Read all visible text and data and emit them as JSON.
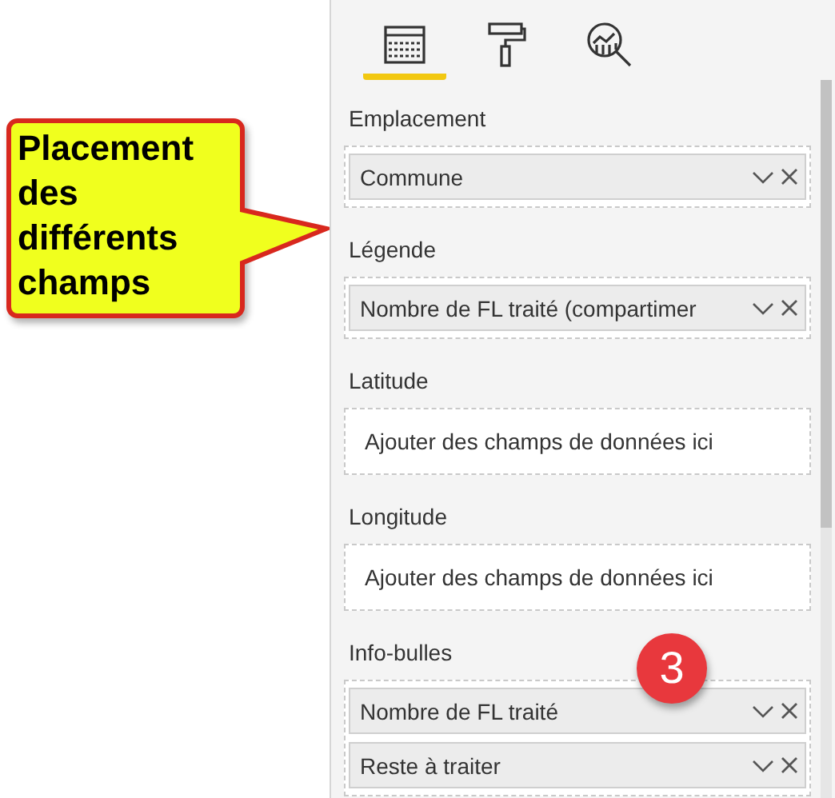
{
  "callout": {
    "text": "Placement des différents champs"
  },
  "panel": {
    "tabs": [
      {
        "kind": "fields",
        "selected": true
      },
      {
        "kind": "format",
        "selected": false
      },
      {
        "kind": "analytics",
        "selected": false
      }
    ],
    "badge": "3",
    "sections": [
      {
        "label": "Emplacement",
        "fields": [
          "Commune"
        ]
      },
      {
        "label": "Légende",
        "fields": [
          "Nombre de FL traité (compartimer"
        ]
      },
      {
        "label": "Latitude",
        "placeholder": "Ajouter des champs de données ici"
      },
      {
        "label": "Longitude",
        "placeholder": "Ajouter des champs de données ici"
      },
      {
        "label": "Info-bulles",
        "fields": [
          "Nombre de FL traité",
          "Reste à traiter"
        ]
      }
    ]
  }
}
